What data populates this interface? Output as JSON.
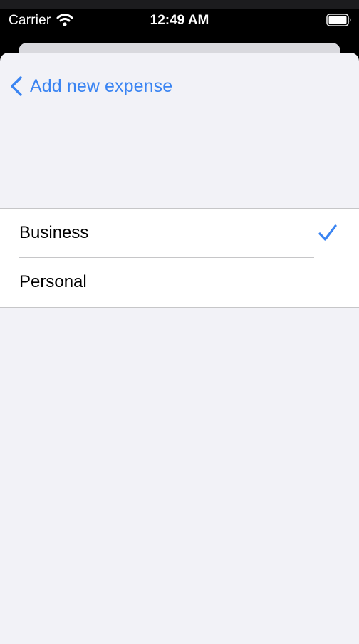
{
  "status_bar": {
    "carrier": "Carrier",
    "time": "12:49 AM",
    "wifi_icon": "wifi-icon",
    "battery_icon": "battery-icon"
  },
  "nav": {
    "back_label": "Add new expense",
    "back_icon": "chevron-left-icon"
  },
  "list": {
    "items": [
      {
        "label": "Business",
        "selected": true
      },
      {
        "label": "Personal",
        "selected": false
      }
    ],
    "check_icon": "checkmark-icon"
  },
  "colors": {
    "accent": "#3a84f2",
    "sheet_background": "#f2f2f7",
    "row_background": "#ffffff",
    "separator": "#c6c6c8",
    "status_bar_background": "#000000"
  }
}
